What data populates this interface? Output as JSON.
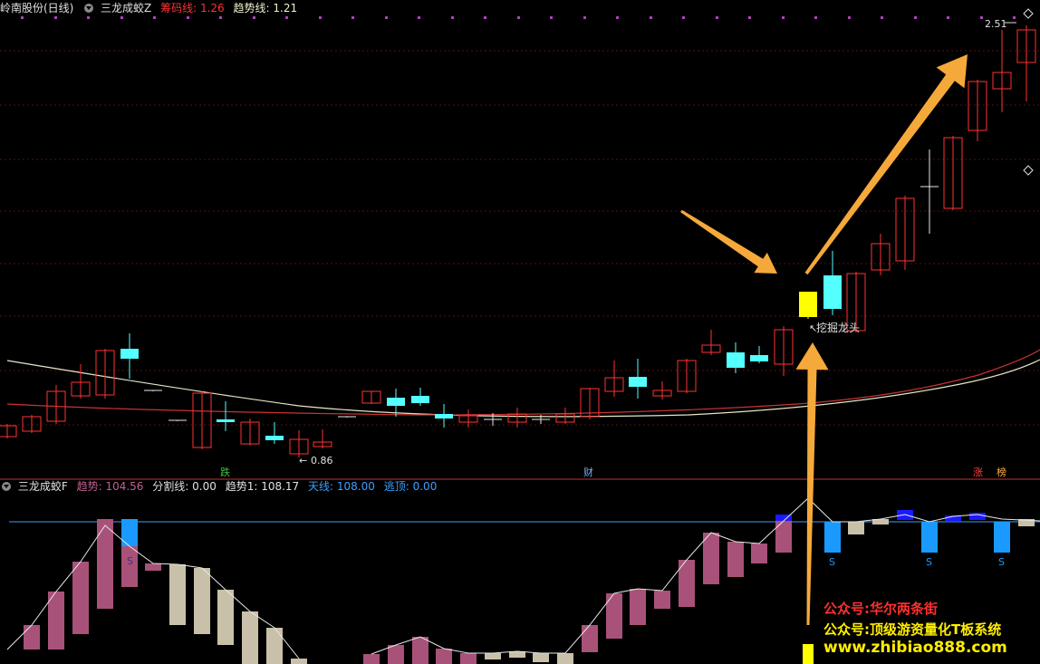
{
  "main_panel": {
    "title": "岭南股份(日线)",
    "indicator_name": "三龙成蛟Z",
    "chip_line_label": "筹码线:",
    "chip_line_value": "1.26",
    "trend_line_label": "趋势线:",
    "trend_line_value": "1.21",
    "high_price_label": "2.51",
    "low_price_label": "0.86",
    "annotation_text": "挖掘龙头",
    "event_markers": [
      "跌",
      "财",
      "涨",
      "榜"
    ]
  },
  "sub_panel": {
    "indicator_name": "三龙成蛟F",
    "fields": [
      {
        "label": "趋势:",
        "value": "104.56"
      },
      {
        "label": "分割线:",
        "value": "0.00"
      },
      {
        "label": "趋势1:",
        "value": "108.17"
      },
      {
        "label": "天线:",
        "value": "108.00"
      },
      {
        "label": "逃顶:",
        "value": "0.00"
      }
    ],
    "signal_label": "S"
  },
  "watermark": {
    "line1": "公众号:华尔两条街",
    "line2": "公众号:顶级游资量化T板系统",
    "line3": "www.zhibiao888.com"
  },
  "colors": {
    "up_candle": "#ff3232",
    "down_candle": "#54ffff",
    "signal_candle": "#ffff00",
    "ma_white": "#e6e6c8",
    "ma_red": "#c83232",
    "bar_pink": "#a8527a",
    "bar_beige": "#c8c0a8",
    "bar_blue": "#1a9aff",
    "bar_navy": "#1a1aff",
    "arrow": "#f5a93a",
    "separator": "#c83232",
    "sky_line": "#3aa0ff"
  }
}
